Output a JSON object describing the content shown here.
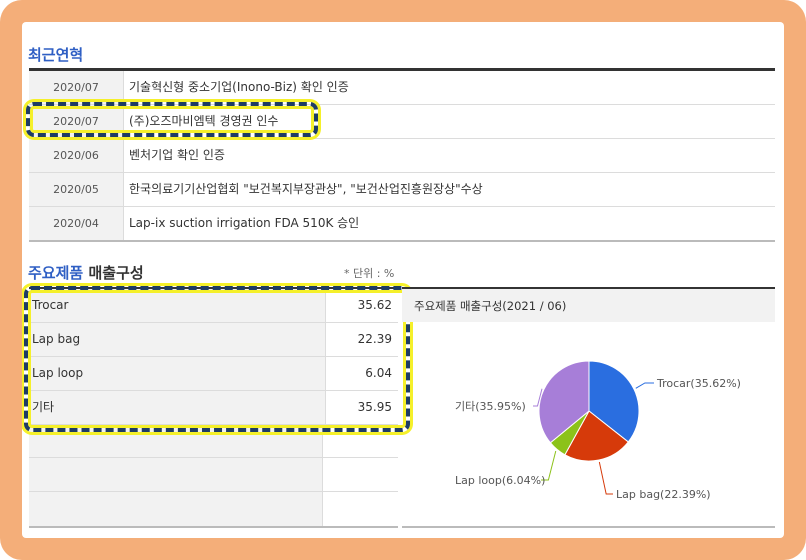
{
  "history": {
    "title": "최근연혁",
    "rows": [
      {
        "date": "2020/07",
        "text": "기술혁신형 중소기업(Inono-Biz) 확인 인증"
      },
      {
        "date": "2020/07",
        "text": "(주)오즈마비엠텍 경영권 인수"
      },
      {
        "date": "2020/06",
        "text": "벤처기업 확인 인증"
      },
      {
        "date": "2020/05",
        "text": "한국의료기기산업협회 \"보건복지부장관상\", \"보건산업진흥원장상\"수상"
      },
      {
        "date": "2020/04",
        "text": "Lap-ix suction irrigation FDA 510K 승인"
      }
    ]
  },
  "sales": {
    "title_blue": "주요제품",
    "title_dark": "매출구성",
    "unit": "* 단위 : %",
    "rows": [
      {
        "name": "Trocar",
        "value": "35.62"
      },
      {
        "name": "Lap bag",
        "value": "22.39"
      },
      {
        "name": "Lap loop",
        "value": "6.04"
      },
      {
        "name": "기타",
        "value": "35.95"
      }
    ]
  },
  "chart_data": {
    "type": "pie",
    "title": "주요제품 매출구성(2021 / 06)",
    "slices": [
      {
        "name": "Trocar",
        "value": 35.62,
        "label": "Trocar(35.62%)",
        "color": "#2a6ee0"
      },
      {
        "name": "Lap bag",
        "value": 22.39,
        "label": "Lap bag(22.39%)",
        "color": "#d63a0a"
      },
      {
        "name": "Lap loop",
        "value": 6.04,
        "label": "Lap loop(6.04%)",
        "color": "#8cc21a"
      },
      {
        "name": "기타",
        "value": 35.95,
        "label": "기타(35.95%)",
        "color": "#a77ed8"
      }
    ]
  }
}
